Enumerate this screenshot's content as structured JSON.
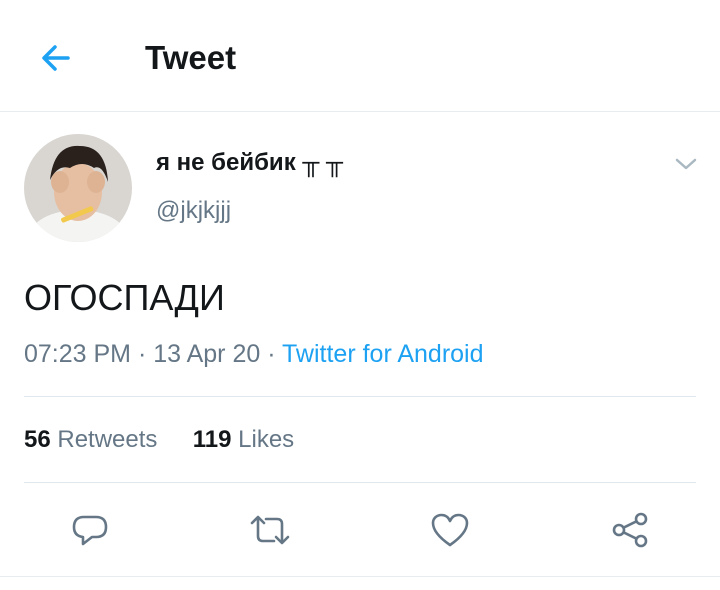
{
  "header": {
    "title": "Tweet",
    "back_icon": "arrow-left-icon"
  },
  "tweet": {
    "author_name": "я не бейбик ╥ ╥",
    "author_handle": "@jkjkjjj",
    "text": "ОГОСПАДИ",
    "time": "07:23 PM",
    "date": "13 Apr 20",
    "separator": " · ",
    "source": "Twitter for Android"
  },
  "stats": {
    "retweets_count": "56",
    "retweets_label": "Retweets",
    "likes_count": "119",
    "likes_label": "Likes"
  },
  "actions": [
    "reply-icon",
    "retweet-icon",
    "like-icon",
    "share-icon"
  ],
  "colors": {
    "accent": "#1da1f2",
    "text": "#14171a",
    "secondary": "#657786",
    "divider": "#e1e8ed"
  }
}
